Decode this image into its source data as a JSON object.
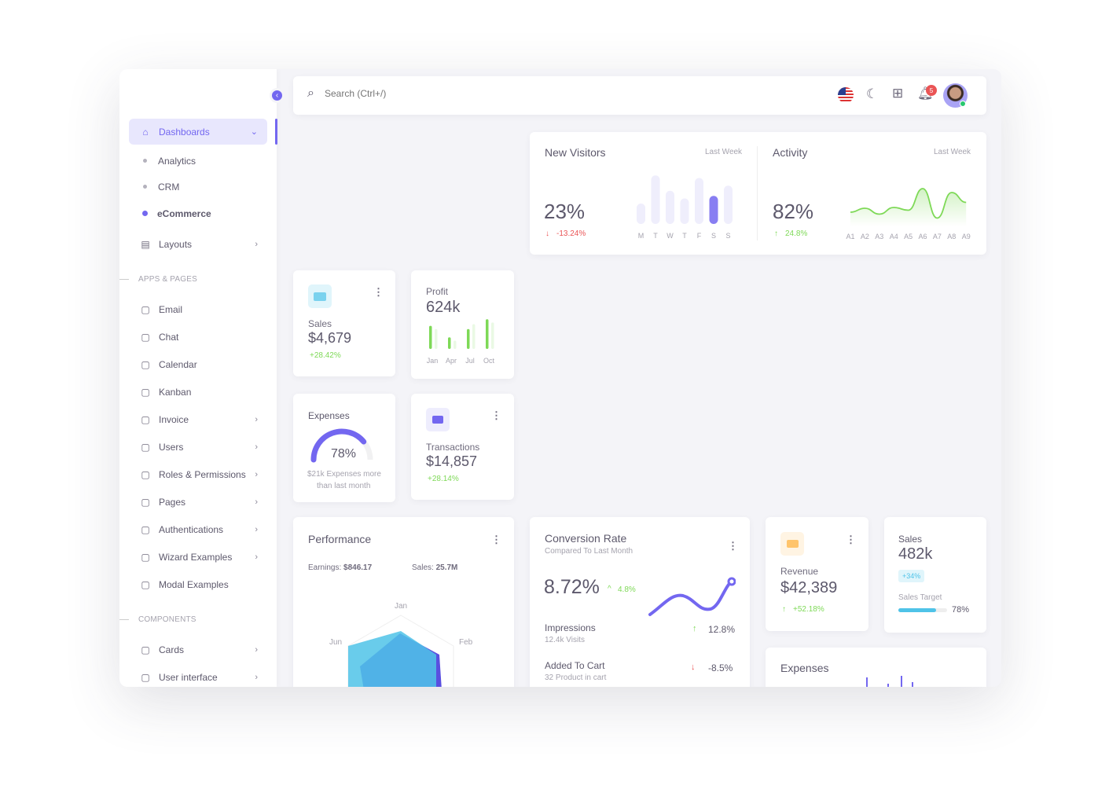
{
  "sidebar": {
    "dashboards": "Dashboards",
    "sub": [
      "Analytics",
      "CRM",
      "eCommerce"
    ],
    "layouts": "Layouts",
    "section_apps": "APPS & PAGES",
    "apps": [
      {
        "label": "Email",
        "icon": "mail-icon",
        "chev": false
      },
      {
        "label": "Chat",
        "icon": "chat-icon",
        "chev": false
      },
      {
        "label": "Calendar",
        "icon": "calendar-icon",
        "chev": false
      },
      {
        "label": "Kanban",
        "icon": "kanban-icon",
        "chev": false
      },
      {
        "label": "Invoice",
        "icon": "invoice-icon",
        "chev": true
      },
      {
        "label": "Users",
        "icon": "user-icon",
        "chev": true
      },
      {
        "label": "Roles & Permissions",
        "icon": "shield-icon",
        "chev": true
      },
      {
        "label": "Pages",
        "icon": "pages-icon",
        "chev": true
      },
      {
        "label": "Authentications",
        "icon": "lock-icon",
        "chev": true
      },
      {
        "label": "Wizard Examples",
        "icon": "wizard-icon",
        "chev": true
      },
      {
        "label": "Modal Examples",
        "icon": "modal-icon",
        "chev": false
      }
    ],
    "section_components": "COMPONENTS",
    "components": [
      {
        "label": "Cards",
        "icon": "cards-icon",
        "chev": true
      },
      {
        "label": "User interface",
        "icon": "ui-icon",
        "chev": true
      }
    ]
  },
  "navbar": {
    "search_placeholder": "Search (Ctrl+/)",
    "notifications": "5"
  },
  "colors": {
    "primary": "#7367f0",
    "success": "#7ed957",
    "danger": "#ea5455",
    "info": "#4fc3e8"
  },
  "visitors": {
    "title": "New Visitors",
    "period": "Last Week",
    "value": "23%",
    "change": "-13.24%",
    "days": [
      "M",
      "T",
      "W",
      "T",
      "F",
      "S",
      "S"
    ],
    "bars": [
      40,
      95,
      65,
      50,
      90,
      55,
      75
    ],
    "active_index": 5
  },
  "activity": {
    "title": "Activity",
    "period": "Last Week",
    "value": "82%",
    "change": "24.8%",
    "labels": [
      "A1",
      "A2",
      "A3",
      "A4",
      "A5",
      "A6",
      "A7",
      "A8",
      "A9"
    ],
    "values": [
      30,
      40,
      25,
      42,
      35,
      90,
      15,
      80,
      55
    ]
  },
  "sales_card": {
    "label": "Sales",
    "value": "$4,679",
    "change": "+28.42%"
  },
  "profit": {
    "label": "Profit",
    "value": "624k",
    "months": [
      "Jan",
      "Apr",
      "Jul",
      "Oct"
    ],
    "bars": [
      [
        70,
        60
      ],
      [
        35,
        25
      ],
      [
        60,
        75
      ],
      [
        90,
        80
      ]
    ]
  },
  "expenses_card": {
    "label": "Expenses",
    "value": "78%",
    "note1": "$21k Expenses more",
    "note2": "than last month",
    "percent": 78
  },
  "transactions": {
    "label": "Transactions",
    "value": "$14,857",
    "change": "+28.14%"
  },
  "performance": {
    "title": "Performance",
    "earnings_label": "Earnings:",
    "earnings": "$846.17",
    "sales_label": "Sales:",
    "sales": "25.7M",
    "axes": [
      "Jan",
      "Feb",
      "Jun"
    ]
  },
  "conversion": {
    "title": "Conversion Rate",
    "subtitle": "Compared To Last Month",
    "value": "8.72%",
    "change": "4.8%",
    "rows": [
      {
        "label": "Impressions",
        "sub": "12.4k Visits",
        "value": "12.8%",
        "dir": "up"
      },
      {
        "label": "Added To Cart",
        "sub": "32 Product in cart",
        "value": "-8.5%",
        "dir": "down"
      }
    ]
  },
  "revenue": {
    "label": "Revenue",
    "value": "$42,389",
    "change": "+52.18%"
  },
  "sales482": {
    "label": "Sales",
    "value": "482k",
    "badge": "+34%",
    "target_label": "Sales Target",
    "target": "78%",
    "percent": 78
  },
  "expenses_bottom": {
    "title": "Expenses"
  }
}
